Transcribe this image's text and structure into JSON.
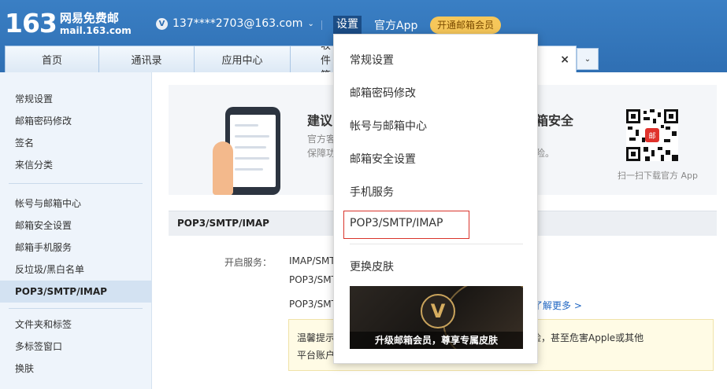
{
  "header": {
    "logo_number": "163",
    "logo_cn": "网易免费邮",
    "logo_en": "mail.163.com",
    "account_badge": "V",
    "account_email": "137****2703@163.com",
    "account_caret": "⌄",
    "nav_settings": "设置",
    "nav_app": "官方App",
    "vip_button": "开通邮箱会员"
  },
  "tabs": {
    "items": [
      {
        "label": "首页"
      },
      {
        "label": "通讯录"
      },
      {
        "label": "应用中心"
      },
      {
        "label": "收件箱"
      }
    ],
    "close_glyph": "×",
    "more_glyph": "⌄"
  },
  "sidebar": {
    "group1": [
      "常规设置",
      "邮箱密码修改",
      "签名",
      "来信分类"
    ],
    "group2": [
      "帐号与邮箱中心",
      "邮箱安全设置",
      "邮箱手机服务",
      "反垃圾/黑白名单",
      "POP3/SMTP/IMAP"
    ],
    "group3": [
      "文件夹和标签",
      "多标签窗口",
      "换肤"
    ]
  },
  "banner": {
    "title_left": "建议",
    "sub_left_1": "官方客",
    "sub_left_2": "保障功",
    "title_right": "箱安全",
    "sub_right": "险。",
    "qr_badge": "邮",
    "qr_caption": "扫一扫下载官方 App"
  },
  "section": {
    "title": "POP3/SMTP/IMAP",
    "service_label": "开启服务：",
    "line1": "IMAP/SMT",
    "line2": "POP3/SMT",
    "line3": "POP3/SMT",
    "learn_more": "了解更多 >",
    "tip_l1": "温馨提示",
    "tip_l2": "平台账户",
    "tip_r1": "险，甚至危害Apple或其他"
  },
  "dropdown": {
    "items": [
      "常规设置",
      "邮箱密码修改",
      "帐号与邮箱中心",
      "邮箱安全设置",
      "手机服务",
      "POP3/SMTP/IMAP",
      "更换皮肤"
    ],
    "skin_badge": "V",
    "skin_caption": "升级邮箱会员，尊享专属皮肤"
  },
  "colors": {
    "header_blue": "#2f6fb3",
    "highlight_red": "#d9342b",
    "vip_gold": "#f6c75a",
    "link_blue": "#2066c2"
  }
}
